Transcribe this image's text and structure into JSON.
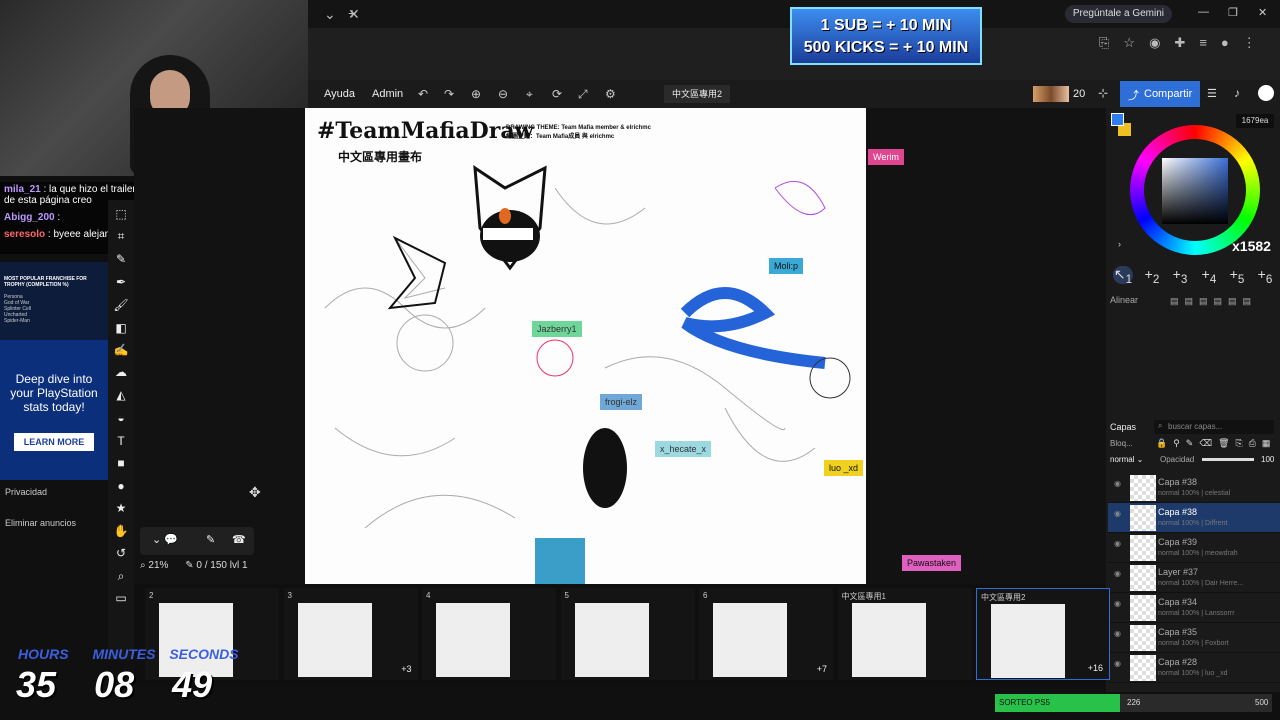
{
  "browser": {
    "gemini_label": "Pregúntale a Gemini",
    "new_tab": "+",
    "close_tab": "✕"
  },
  "banner": {
    "line1": "1 SUB = + 10 MIN",
    "line2": "500 KICKS = + 10 MIN"
  },
  "app": {
    "menu": [
      "Ayuda",
      "Admin"
    ],
    "room_name": "中文區專用2",
    "online_count": "20",
    "share_label": "Compartir"
  },
  "chat": {
    "messages": [
      {
        "user": "mila_21",
        "text": ": la que hizo el trailer dio la idea de esta página creo"
      },
      {
        "user": "Abigg_200",
        "text": ":"
      },
      {
        "user": "seresolo",
        "text": ": byeee alejandra"
      }
    ]
  },
  "ad": {
    "top_title": "MOST POPULAR FRANCHISE FOR TROPHY (COMPLETION %)",
    "rows": [
      "Persona",
      "God of War",
      "Splinter Cell",
      "Uncharted",
      "Spider-Man"
    ],
    "headline": "Deep dive into your PlayStation stats today!",
    "cta": "LEARN MORE",
    "privacy": "Privacidad",
    "remove_ads": "Eliminar anuncios"
  },
  "canvas": {
    "title": "#TeamMafiaDraw",
    "subtitle": "中文區專用畫布",
    "theme_line1": "DRAWING THEME: Team Mafia member & elrichmc",
    "theme_line2": "繪圖主題：Team Mafia成員 與 elrichmc",
    "cursors": [
      {
        "name": "Werim",
        "color": "#e0468f"
      },
      {
        "name": "Moli:p",
        "color": "#3aa9d6"
      },
      {
        "name": "Jazberry1",
        "color": "#6fd69a"
      },
      {
        "name": "frogi-elz",
        "color": "#6fa8d6"
      },
      {
        "name": "x_hecate_x",
        "color": "#9cd8e0"
      },
      {
        "name": "luo _xd",
        "color": "#f0d020"
      },
      {
        "name": "Pawastaken",
        "color": "#e060c0"
      }
    ]
  },
  "status": {
    "zoom": "21%",
    "strokes": "0 / 150",
    "level": "lvl 1"
  },
  "color": {
    "hex": "1679ea",
    "primary": "#2d7df0",
    "secondary": "#f0c020",
    "wheel_overlay": "x1582"
  },
  "brushes": {
    "slots": [
      "1",
      "2",
      "3",
      "4",
      "5",
      "6"
    ],
    "align_label": "Alinear"
  },
  "layers": {
    "header": "Capas",
    "search_placeholder": "buscar capas...",
    "lock_label": "Bloq...",
    "blend_mode": "normal",
    "opacity_label": "Opacidad",
    "opacity_value": "100",
    "items": [
      {
        "name": "Capa #38",
        "sub": "normal 100%",
        "owner": "celestial"
      },
      {
        "name": "Capa #38",
        "sub": "normal 100%",
        "owner": "Diffrent"
      },
      {
        "name": "Capa #39",
        "sub": "normal 100%",
        "owner": "meowdrah"
      },
      {
        "name": "Layer #37",
        "sub": "normal 100%",
        "owner": "Dair Herre..."
      },
      {
        "name": "Capa #34",
        "sub": "normal 100%",
        "owner": "Lanssorrr"
      },
      {
        "name": "Capa #35",
        "sub": "normal 100%",
        "owner": "Foxbort"
      },
      {
        "name": "Capa #28",
        "sub": "normal 100%",
        "owner": "luo _xd"
      }
    ]
  },
  "pages": [
    {
      "label": "2",
      "extra": ""
    },
    {
      "label": "3",
      "extra": "+3"
    },
    {
      "label": "4",
      "extra": ""
    },
    {
      "label": "5",
      "extra": ""
    },
    {
      "label": "6",
      "extra": "+7"
    },
    {
      "label": "中文區專用1",
      "extra": ""
    },
    {
      "label": "中文區專用2",
      "extra": "+16"
    }
  ],
  "timer": {
    "labels": [
      "HOURS",
      "MINUTES",
      "SECONDS"
    ],
    "values": [
      "35",
      "08",
      "49"
    ]
  },
  "sorteo": {
    "label": "SORTEO PS5",
    "value": "226",
    "max": "500",
    "progress": 0.452
  }
}
